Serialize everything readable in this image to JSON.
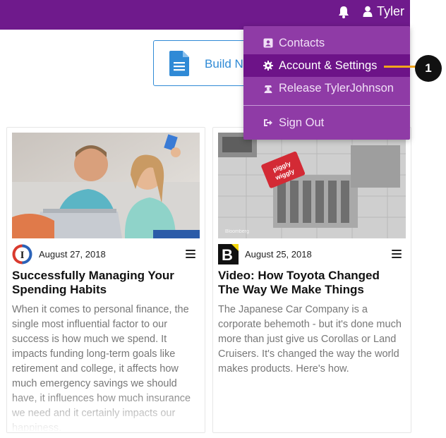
{
  "header": {
    "user_name": "Tyler",
    "bell_icon": "bell-icon",
    "user_icon": "user-icon",
    "color": "#6f1a8c"
  },
  "build_button": {
    "label": "Build Ne",
    "icon": "document-icon",
    "color": "#2f8ad6"
  },
  "dropdown": {
    "items": [
      {
        "label": "Contacts",
        "icon": "address-book-icon",
        "active": false
      },
      {
        "label": "Account & Settings",
        "icon": "gear-icon",
        "active": true
      },
      {
        "label": "Release TylerJohnson",
        "icon": "user-secret-icon",
        "active": false
      },
      {
        "label": "Sign Out",
        "icon": "sign-out-icon",
        "active": false
      }
    ],
    "colors": {
      "background": "#8f3ba6",
      "active": "#6d1388"
    }
  },
  "callout": {
    "number": "1",
    "color": "#f2a51c"
  },
  "cards": [
    {
      "date": "August 27, 2018",
      "title": "Successfully Managing Your Spending Habits",
      "excerpt": "When it comes to personal finance, the single most influential factor to our success is how much we spend. It impacts funding long-term goals like retirement and college, it affects how much emergency savings we should have, it influences how much insurance we need and it certainly impacts our happiness.",
      "source_logo": "I",
      "image": "couple-laptop-photo"
    },
    {
      "date": "August 25, 2018",
      "title": "Video: How Toyota Changed The Way We Make Things",
      "excerpt": "The Japanese Car Company is a corporate behemoth - but it's done much more than just give us Corollas or Land Cruisers. It's changed the way the world makes products. Here's how.",
      "source_logo": "B",
      "image": "piggly-wiggly-store-photo",
      "image_text": {
        "brand": "piggly wiggly",
        "watermark": "Bloomberg"
      }
    }
  ]
}
